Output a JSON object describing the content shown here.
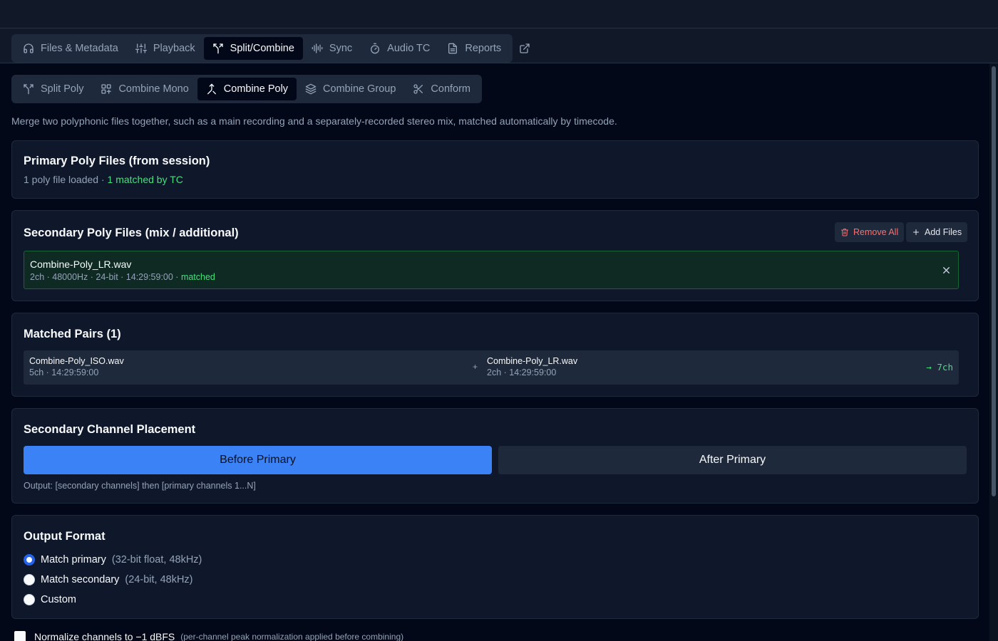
{
  "main_tabs": [
    {
      "label": "Files & Metadata",
      "icon": "headphones-icon"
    },
    {
      "label": "Playback",
      "icon": "sliders-icon"
    },
    {
      "label": "Split/Combine",
      "icon": "split-icon",
      "active": true
    },
    {
      "label": "Sync",
      "icon": "waveform-icon"
    },
    {
      "label": "Audio TC",
      "icon": "timer-icon"
    },
    {
      "label": "Reports",
      "icon": "document-icon"
    }
  ],
  "sub_tabs": [
    {
      "label": "Split Poly",
      "icon": "split-icon"
    },
    {
      "label": "Combine Mono",
      "icon": "grid-icon"
    },
    {
      "label": "Combine Poly",
      "icon": "merge-icon",
      "active": true
    },
    {
      "label": "Combine Group",
      "icon": "layers-icon"
    },
    {
      "label": "Conform",
      "icon": "scissors-icon"
    }
  ],
  "description": "Merge two polyphonic files together, such as a main recording and a separately-recorded stereo mix, matched automatically by timecode.",
  "primary": {
    "title": "Primary Poly Files (from session)",
    "loaded_text": "1 poly file loaded · ",
    "matched_text": "1 matched by TC"
  },
  "secondary": {
    "title": "Secondary Poly Files (mix / additional)",
    "remove_all_label": "Remove All",
    "add_files_label": "Add Files",
    "file": {
      "name": "Combine-Poly_LR.wav",
      "details": "2ch · 48000Hz · 24-bit · 14:29:59:00 · ",
      "status": "matched"
    }
  },
  "matched_pairs": {
    "title": "Matched Pairs (1)",
    "pair": {
      "left_name": "Combine-Poly_ISO.wav",
      "left_details": "5ch · 14:29:59:00",
      "plus": "+",
      "right_name": "Combine-Poly_LR.wav",
      "right_details": "2ch · 14:29:59:00",
      "result": "→ 7ch"
    }
  },
  "placement": {
    "title": "Secondary Channel Placement",
    "before_label": "Before Primary",
    "after_label": "After Primary",
    "output_note": "Output: [secondary channels] then [primary channels 1...N]"
  },
  "output_format": {
    "title": "Output Format",
    "options": [
      {
        "label": "Match primary",
        "detail": "(32-bit float, 48kHz)",
        "checked": true
      },
      {
        "label": "Match secondary",
        "detail": "(24-bit, 48kHz)",
        "checked": false
      },
      {
        "label": "Custom",
        "detail": "",
        "checked": false
      }
    ]
  },
  "normalize": {
    "label": "Normalize channels to −1 dBFS",
    "note": "(per-channel peak normalization applied before combining)"
  },
  "colors": {
    "accent": "#3b82f6",
    "success": "#4ade80",
    "danger": "#f87171",
    "background": "#020817",
    "card": "#0f172a"
  }
}
